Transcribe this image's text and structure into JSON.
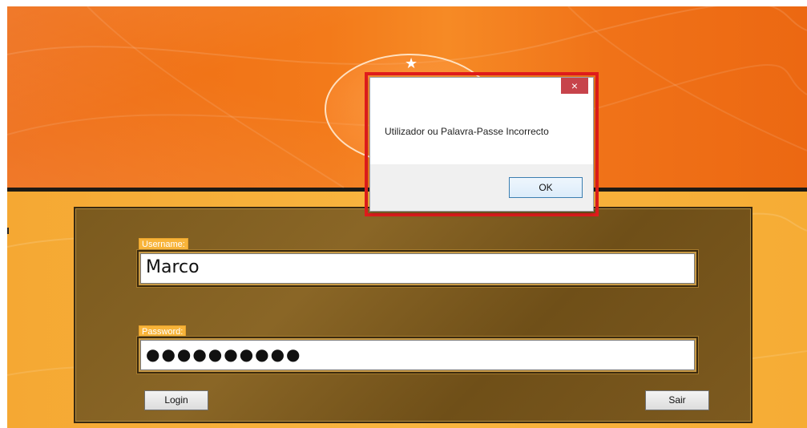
{
  "login": {
    "username_label": "Username:",
    "username_value": "Marco",
    "password_label": "Password:",
    "password_value": "●●●●●●●●●●",
    "login_button": "Login",
    "exit_button": "Sair"
  },
  "logo": {
    "star": "★"
  },
  "dialog": {
    "close_glyph": "×",
    "message": "Utilizador ou Palavra-Passe Incorrecto",
    "ok_button": "OK"
  },
  "colors": {
    "banner_orange": "#f37a1a",
    "panel_brown": "#7b5a1e",
    "highlight_red": "#e01c1c",
    "close_red": "#c7434b"
  }
}
